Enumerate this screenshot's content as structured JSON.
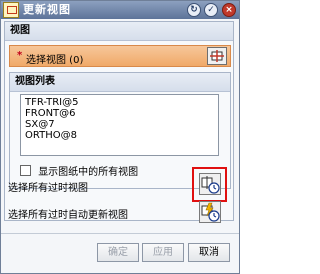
{
  "window": {
    "title": "更新视图"
  },
  "view_section": {
    "header": "视图",
    "select_required_mark": "*",
    "select_label": "选择视图 (0)",
    "list_group": {
      "header": "视图列表",
      "items": [
        "TFR-TRI@5",
        "FRONT@6",
        "SX@7",
        "ORTHO@8"
      ],
      "show_all_checkbox_label": "显示图纸中的所有视图",
      "show_all_checked": false
    }
  },
  "actions": {
    "select_outdated_label": "选择所有过时视图",
    "select_outdated_auto_label": "选择所有过时自动更新视图"
  },
  "buttons": {
    "ok": "确定",
    "apply": "应用",
    "cancel": "取消"
  },
  "colors": {
    "titlebar": "#6f84a8",
    "select_row": "#f2b27a",
    "highlight": "#e01010"
  }
}
